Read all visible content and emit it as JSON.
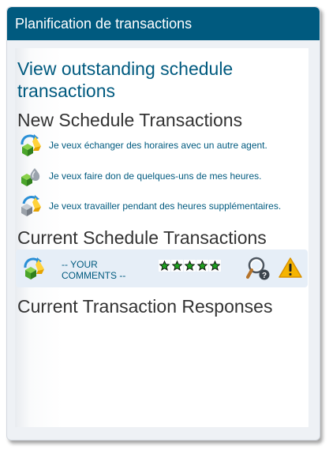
{
  "header": {
    "title": "Planification de transactions"
  },
  "view_outstanding_link": "View outstanding schedule transactions",
  "new_section": {
    "title": "New Schedule Transactions",
    "options": [
      {
        "icon": "exchange-cubes-icon",
        "label": "Je veux échanger des horaires avec un autre agent."
      },
      {
        "icon": "donate-hours-icon",
        "label": "Je veux faire don de quelques-uns de mes heures."
      },
      {
        "icon": "extra-hours-icon",
        "label": "Je veux travailler pendant des heures supplémentaires."
      }
    ]
  },
  "current_section": {
    "title": "Current Schedule Transactions",
    "rows": [
      {
        "icon": "exchange-cubes-icon",
        "comments": "-- YOUR COMMENTS --",
        "rating": 5,
        "rating_max": 5,
        "actions": [
          "view-details-icon",
          "warning-icon"
        ]
      }
    ]
  },
  "responses_section": {
    "title": "Current Transaction Responses"
  },
  "colors": {
    "header_bg": "#005a7f",
    "link": "#005a7f",
    "star": "#1fa31f",
    "warning": "#f5b400",
    "row_bg": "#e6eef7"
  }
}
